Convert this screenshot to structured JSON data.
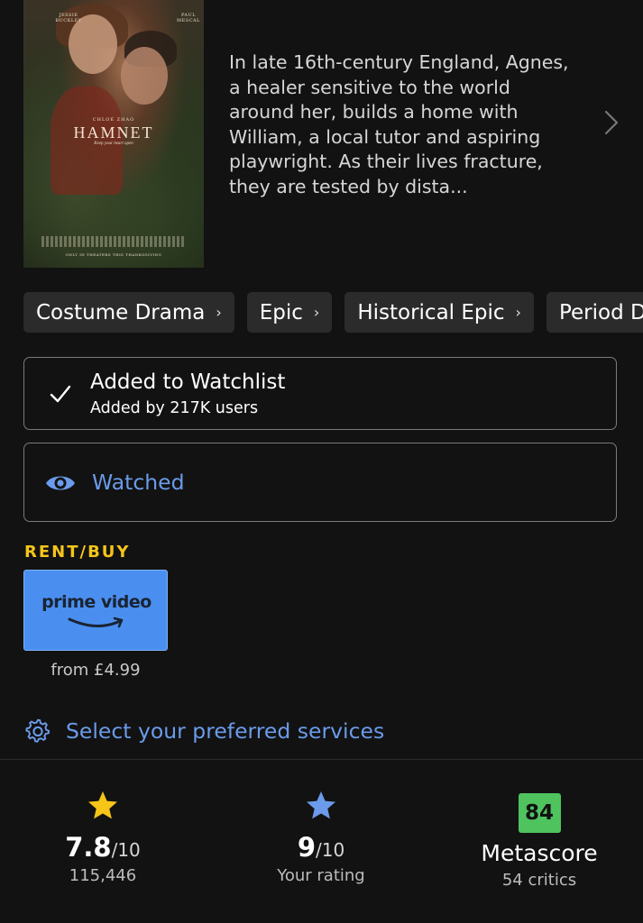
{
  "poster": {
    "title": "HAMNET",
    "director_credit": "CHLOÉ ZHAO",
    "tagline": "Keep your heart open",
    "cast_left": "JESSIE BUCKLEY",
    "cast_right": "PAUL MESCAL",
    "bottom_line": "ONLY IN THEATERS THIS THANKSGIVING"
  },
  "synopsis": "In late 16th-century England, Agnes, a healer sensitive to the world around her, builds a home with William, a local tutor and aspiring playwright. As their lives fracture, they are tested by dista...",
  "genres": [
    "Costume Drama",
    "Epic",
    "Historical Epic",
    "Period Drama"
  ],
  "watchlist": {
    "title": "Added to Watchlist",
    "subtitle": "Added by 217K users"
  },
  "watched": {
    "label": "Watched"
  },
  "rent_buy": {
    "heading": "RENT/BUY",
    "provider_logo_text": "prime video",
    "price": "from £4.99"
  },
  "preferred_services": {
    "label": "Select your preferred services"
  },
  "ratings": {
    "imdb": {
      "score": "7.8",
      "out_of": "/10",
      "count": "115,446"
    },
    "user": {
      "score": "9",
      "out_of": "/10",
      "label": "Your rating"
    },
    "metascore": {
      "score": "84",
      "label": "Metascore",
      "critics": "54 critics"
    }
  },
  "colors": {
    "accent_blue": "#6b9bea",
    "imdb_yellow": "#f5c518",
    "metascore_green": "#4fc35e",
    "prime_blue": "#4a8ff0"
  }
}
